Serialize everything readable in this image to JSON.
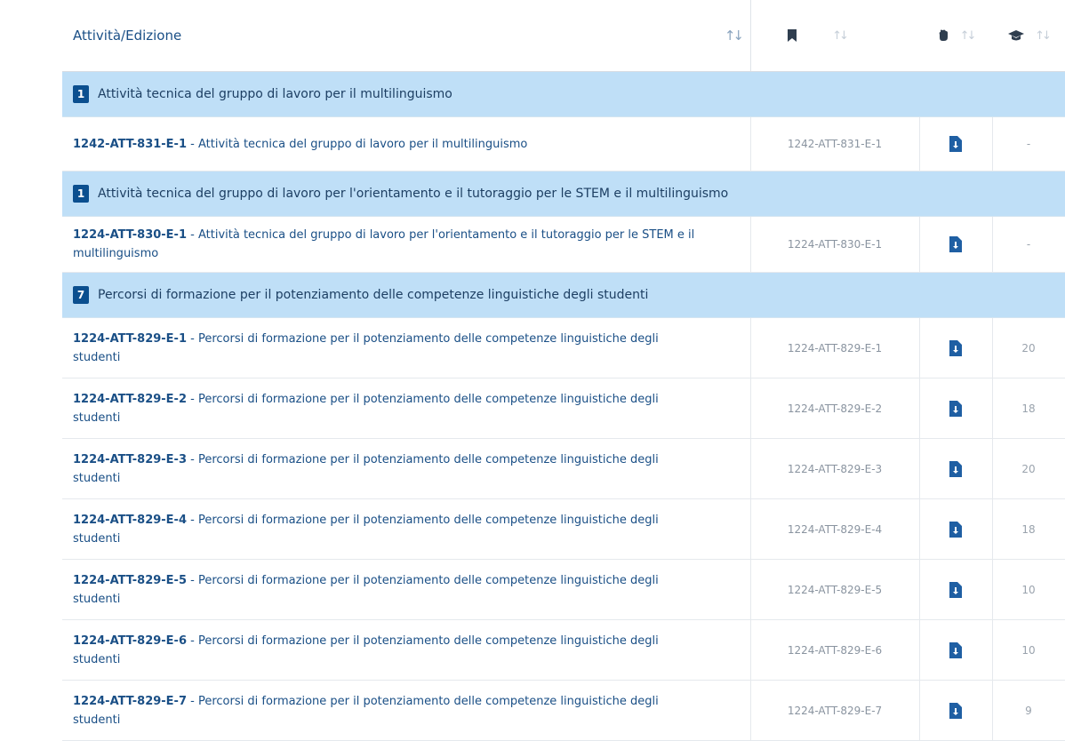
{
  "header": {
    "activity_label": "Attività/Edizione",
    "sort_glyph": "↑↓"
  },
  "icons": {
    "bookmark": "bookmark-icon",
    "document": "document-download-icon",
    "students": "graduation-cap-icon"
  },
  "colors": {
    "group_bg": "#bfdff7",
    "badge_bg": "#0b4f8f",
    "link": "#1a4f86"
  },
  "groups": [
    {
      "count": "1",
      "title": "Attività tecnica del gruppo di lavoro per il multilinguismo",
      "rows": [
        {
          "code": "1242-ATT-831-E-1",
          "desc": " - Attività tecnica del gruppo di lavoro per il multilinguismo",
          "code_col": "1242-ATT-831-E-1",
          "students": "-"
        }
      ]
    },
    {
      "count": "1",
      "title": "Attività tecnica del gruppo di lavoro per l'orientamento e il tutoraggio per le STEM e il multilinguismo",
      "rows": [
        {
          "code": "1224-ATT-830-E-1",
          "desc": " - Attività tecnica del gruppo di lavoro per l'orientamento e il tutoraggio per le STEM e il multilinguismo",
          "code_col": "1224-ATT-830-E-1",
          "students": "-"
        }
      ]
    },
    {
      "count": "7",
      "title": "Percorsi di formazione per il potenziamento delle competenze linguistiche degli studenti",
      "rows": [
        {
          "code": "1224-ATT-829-E-1",
          "desc": " - Percorsi di formazione per il potenziamento delle competenze linguistiche degli studenti",
          "code_col": "1224-ATT-829-E-1",
          "students": "20"
        },
        {
          "code": "1224-ATT-829-E-2",
          "desc": " - Percorsi di formazione per il potenziamento delle competenze linguistiche degli studenti",
          "code_col": "1224-ATT-829-E-2",
          "students": "18"
        },
        {
          "code": "1224-ATT-829-E-3",
          "desc": " - Percorsi di formazione per il potenziamento delle competenze linguistiche degli studenti",
          "code_col": "1224-ATT-829-E-3",
          "students": "20"
        },
        {
          "code": "1224-ATT-829-E-4",
          "desc": " - Percorsi di formazione per il potenziamento delle competenze linguistiche degli studenti",
          "code_col": "1224-ATT-829-E-4",
          "students": "18"
        },
        {
          "code": "1224-ATT-829-E-5",
          "desc": " - Percorsi di formazione per il potenziamento delle competenze linguistiche degli studenti",
          "code_col": "1224-ATT-829-E-5",
          "students": "10"
        },
        {
          "code": "1224-ATT-829-E-6",
          "desc": " - Percorsi di formazione per il potenziamento delle competenze linguistiche degli studenti",
          "code_col": "1224-ATT-829-E-6",
          "students": "10"
        },
        {
          "code": "1224-ATT-829-E-7",
          "desc": " - Percorsi di formazione per il potenziamento delle competenze linguistiche degli studenti",
          "code_col": "1224-ATT-829-E-7",
          "students": "9"
        }
      ]
    }
  ]
}
